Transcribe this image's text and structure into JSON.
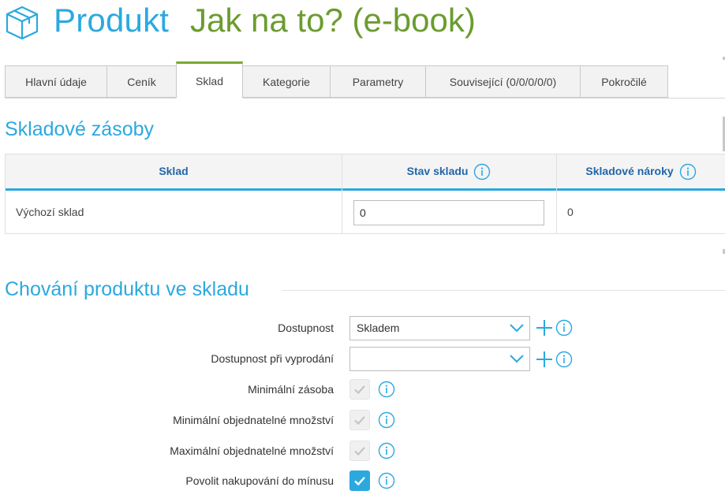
{
  "header": {
    "section": "Produkt",
    "product_name": "Jak na to? (e-book)"
  },
  "tabs": [
    {
      "label": "Hlavní údaje",
      "active": false
    },
    {
      "label": "Ceník",
      "active": false
    },
    {
      "label": "Sklad",
      "active": true
    },
    {
      "label": "Kategorie",
      "active": false
    },
    {
      "label": "Parametry",
      "active": false
    },
    {
      "label": "Související (0/0/0/0/0)",
      "active": false
    },
    {
      "label": "Pokročilé",
      "active": false
    }
  ],
  "stock": {
    "title": "Skladové zásoby",
    "columns": [
      "Sklad",
      "Stav skladu",
      "Skladové nároky"
    ],
    "rows": [
      {
        "warehouse": "Výchozí sklad",
        "stock_value": "0",
        "claims": "0"
      }
    ]
  },
  "behavior": {
    "title": "Chování produktu ve skladu",
    "availability": {
      "label": "Dostupnost",
      "value": "Skladem"
    },
    "availability_sold_out": {
      "label": "Dostupnost při vyprodání",
      "value": ""
    },
    "checks": [
      {
        "label": "Minimální zásoba",
        "checked": false
      },
      {
        "label": "Minimální objednatelné množství",
        "checked": false
      },
      {
        "label": "Maximální objednatelné množství",
        "checked": false
      },
      {
        "label": "Povolit nakupování do mínusu",
        "checked": true
      }
    ]
  },
  "colors": {
    "accent_blue": "#2ba9df",
    "product_green": "#6b9c2f",
    "active_tab_green": "#7aaa2f",
    "header_text_blue": "#2266a8"
  },
  "icons": [
    "box-icon",
    "info-icon",
    "chevron-down-icon",
    "plus-icon",
    "checkmark-icon"
  ]
}
